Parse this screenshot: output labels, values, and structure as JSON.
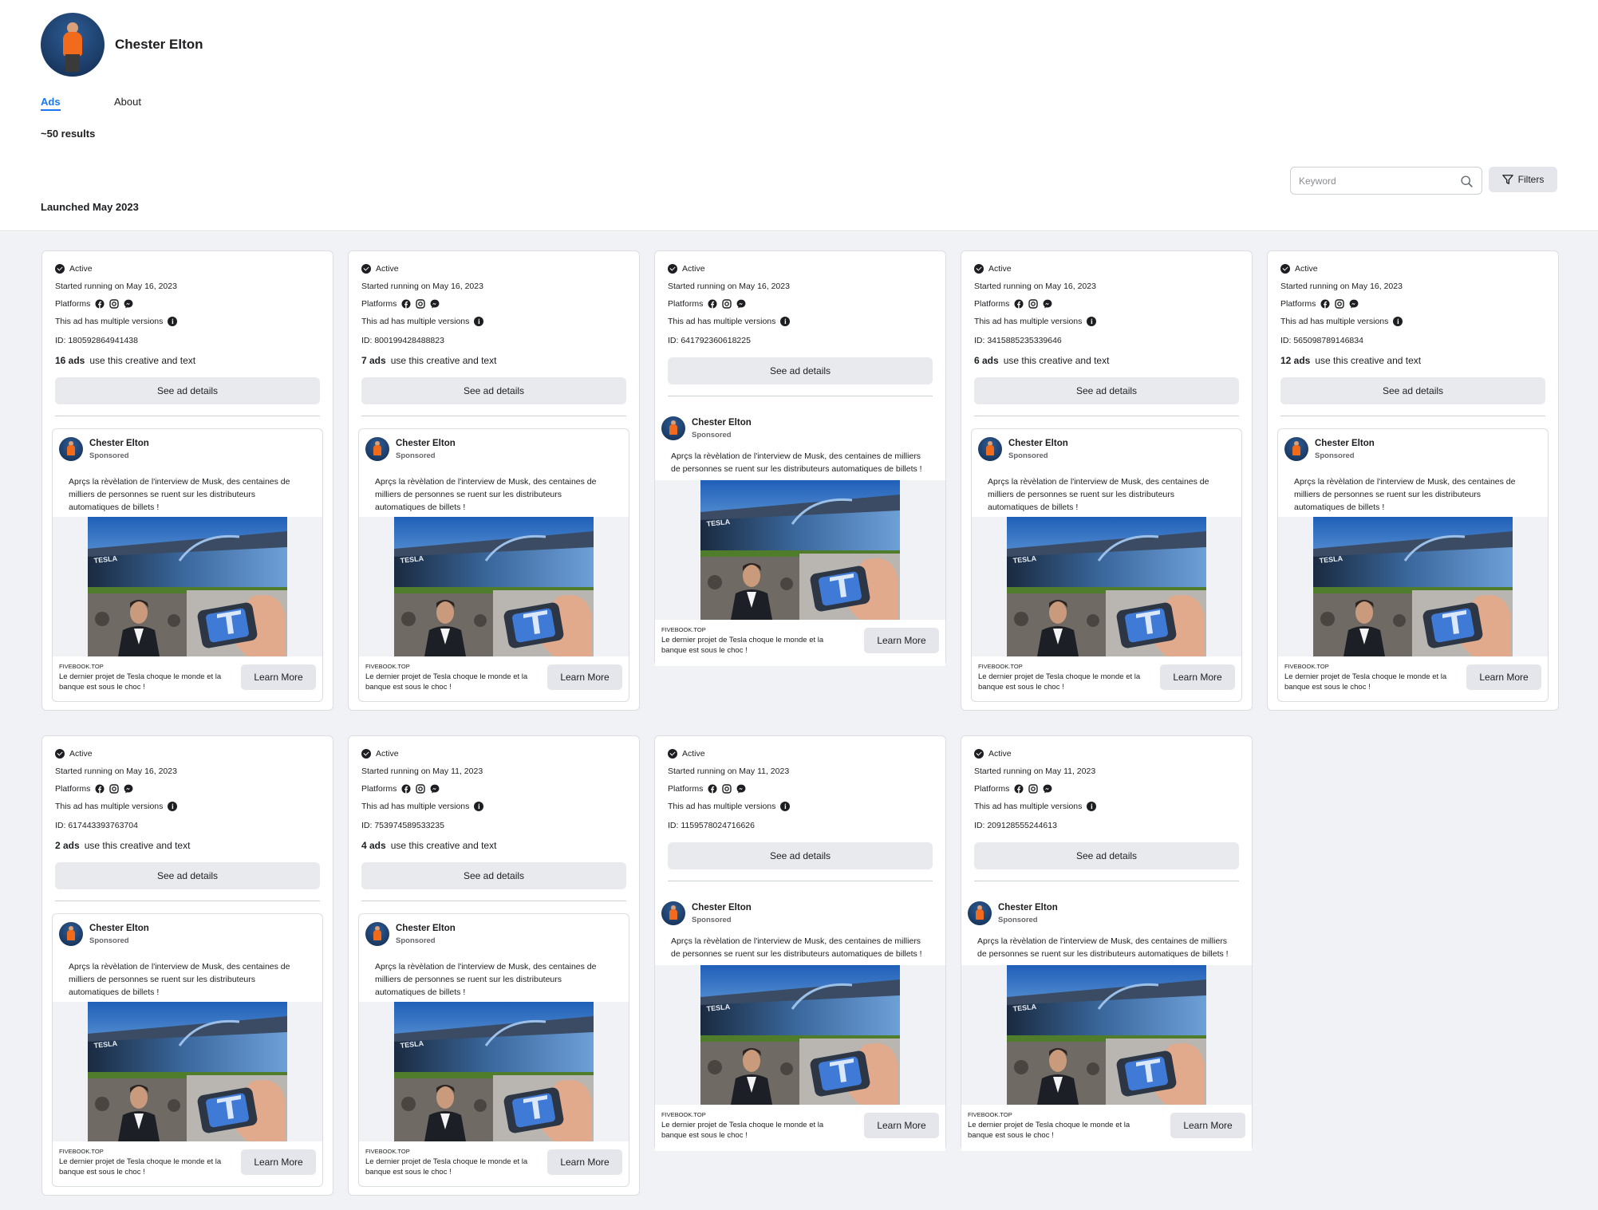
{
  "page": {
    "name": "Chester Elton",
    "tabs": [
      "Ads",
      "About"
    ],
    "results": "~50 results",
    "section_title": "Launched May 2023",
    "search_placeholder": "Keyword",
    "filters_label": "Filters"
  },
  "labels": {
    "active": "Active",
    "platforms": "Platforms",
    "versions": "This ad has multiple versions",
    "see_details": "See ad details",
    "advertiser": "Chester Elton",
    "sponsored": "Sponsored",
    "ad_text": "Aprçs la rèvèlation de l'interview de Musk, des centaines de milliers de personnes se ruent sur les distributeurs automatiques de billets !",
    "domain": "FIVEBOOK.TOP",
    "headline": "Le dernier projet de Tesla choque le monde et la banque est sous le choc !",
    "cta": "Learn More",
    "count_suffix": "use this creative and text"
  },
  "colors": {
    "accent": "#1877f2",
    "background": "#f0f2f5"
  },
  "icons": [
    "facebook-icon",
    "instagram-icon",
    "messenger-icon",
    "info-icon",
    "search-icon",
    "filter-icon",
    "checkmark-icon",
    "more-icon"
  ],
  "cards": [
    {
      "started": "Started running on May 16, 2023",
      "id": "ID: 180592864941438",
      "ads_count": "16 ads"
    },
    {
      "started": "Started running on May 16, 2023",
      "id": "ID: 800199428488823",
      "ads_count": "7 ads"
    },
    {
      "started": "Started running on May 16, 2023",
      "id": "ID: 641792360618225",
      "ads_count": ""
    },
    {
      "started": "Started running on May 16, 2023",
      "id": "ID: 3415885235339646",
      "ads_count": "6 ads"
    },
    {
      "started": "Started running on May 16, 2023",
      "id": "ID: 565098789146834",
      "ads_count": "12 ads"
    },
    {
      "started": "Started running on May 16, 2023",
      "id": "ID: 617443393763704",
      "ads_count": "2 ads"
    },
    {
      "started": "Started running on May 11, 2023",
      "id": "ID: 753974589533235",
      "ads_count": "4 ads"
    },
    {
      "started": "Started running on May 11, 2023",
      "id": "ID: 1159578024716626",
      "ads_count": ""
    },
    {
      "started": "Started running on May 11, 2023",
      "id": "ID: 209128555244613",
      "ads_count": ""
    }
  ]
}
